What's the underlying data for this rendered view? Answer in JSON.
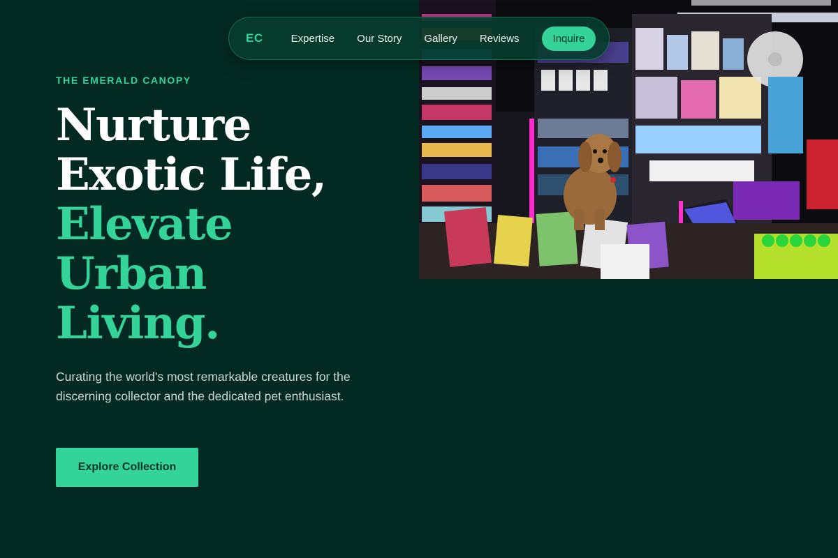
{
  "nav": {
    "logo": "EC",
    "links": [
      "Expertise",
      "Our Story",
      "Gallery",
      "Reviews"
    ],
    "cta": "Inquire"
  },
  "hero": {
    "eyebrow": "THE EMERALD CANOPY",
    "headline_white": [
      "Nurture",
      "Exotic Life,"
    ],
    "headline_green": [
      "Elevate",
      "Urban",
      "Living."
    ],
    "subtitle": "Curating the world's most remarkable creatures for the discerning collector and the dedicated pet enthusiast.",
    "button": "Explore Collection",
    "image": "photo of a poodle dog sitting on a counter inside a colorful convenience store"
  },
  "colors": {
    "background": "#032a22",
    "accent": "#34d399",
    "nav_bg": "#063c2e",
    "text_muted": "#c9d8d2"
  }
}
